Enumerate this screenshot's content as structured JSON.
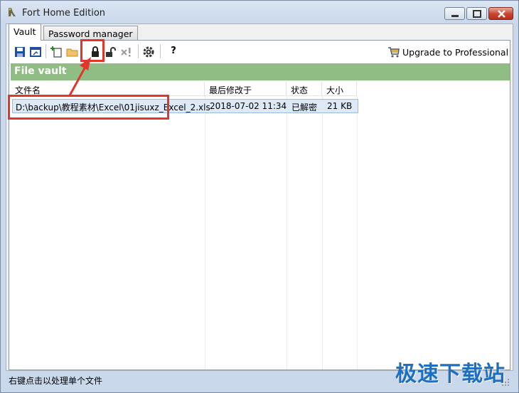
{
  "window": {
    "title": "Fort Home Edition"
  },
  "tabs": [
    {
      "label": "Vault",
      "active": true
    },
    {
      "label": "Password manager",
      "active": false
    }
  ],
  "toolbar": {
    "icons": [
      "save-icon",
      "open-vault-icon",
      "add-file-icon",
      "add-folder-icon",
      "lock-icon",
      "unlock-icon",
      "remove-icon",
      "settings-icon",
      "help-icon"
    ],
    "help_label": "?",
    "upgrade_label": "Upgrade to Professional"
  },
  "vault": {
    "header": "File vault"
  },
  "table": {
    "columns": [
      "文件名",
      "最后修改于",
      "状态",
      "大小"
    ],
    "rows": [
      {
        "name": "D:\\backup\\教程素材\\Excel\\01jisuxz_Excel_2.xls",
        "modified": "2018-07-02 11:34",
        "status": "已解密",
        "size": "21 KB"
      }
    ]
  },
  "statusbar": {
    "text": "右键点击以处理单个文件"
  },
  "watermark": "极速下载站",
  "colors": {
    "vault_bar": "#8fbd83",
    "annotation": "#e0372c",
    "selection": "#dde9f7"
  }
}
